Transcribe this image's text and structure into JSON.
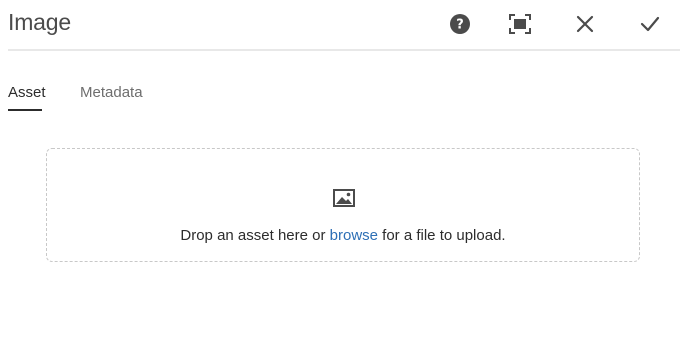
{
  "dialog": {
    "title": "Image"
  },
  "header_actions": {
    "help": "help-icon",
    "fullscreen": "fullscreen-icon",
    "close": "close-icon",
    "done": "checkmark-icon"
  },
  "tabs": [
    {
      "label": "Asset",
      "selected": true
    },
    {
      "label": "Metadata",
      "selected": false
    }
  ],
  "dropzone": {
    "icon": "image-icon",
    "text_before": "Drop an asset here or ",
    "link_text": "browse",
    "text_after": " for a file to upload."
  },
  "colors": {
    "link": "#2d6fb5",
    "divider": "#e8e8e8",
    "icon": "#4b4b4b"
  }
}
